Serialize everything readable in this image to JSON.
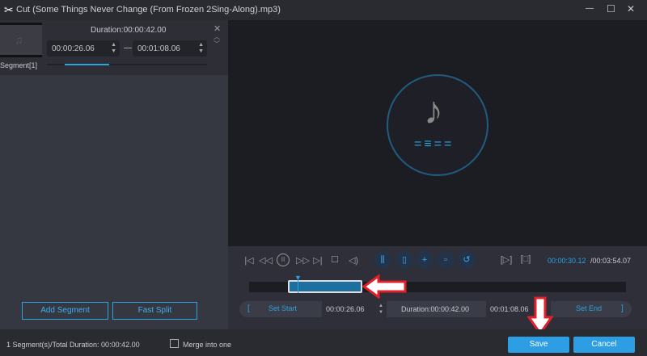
{
  "window": {
    "title": "Cut (Some Things Never Change (From Frozen 2Sing-Along).mp3)",
    "minimize": "—",
    "maximize": "☐",
    "close": "✕"
  },
  "segment": {
    "label": "Segment[1]",
    "duration": "Duration:00:00:42.00",
    "start": "00:00:26.06",
    "end": "00:01:08.06",
    "dash": "—",
    "progress": 0.28
  },
  "left": {
    "add_segment": "Add Segment",
    "fast_split": "Fast Split"
  },
  "player": {
    "current_time": "00:00:30.12",
    "total_time": "/00:03:54.07"
  },
  "cutbar": {
    "set_start": "Set Start",
    "start": "00:00:26.06",
    "duration": "Duration:00:00:42.00",
    "end": "00:01:08.06",
    "set_end": "Set End",
    "bracket_left": "[",
    "bracket_right": "]"
  },
  "bottom": {
    "summary": "1 Segment(s)/Total Duration: 00:00:42.00",
    "merge_label": "Merge into one",
    "merge_checked": false,
    "save": "Save",
    "cancel": "Cancel"
  },
  "colors": {
    "accent": "#2d9ee4",
    "arrow": "#e0202a"
  }
}
